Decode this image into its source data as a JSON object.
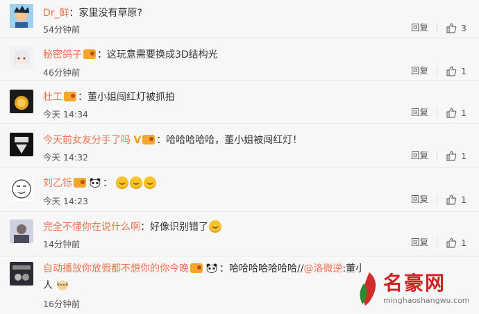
{
  "comments": [
    {
      "user": "Dr_鲜",
      "text": "家里没有草原?",
      "time": "54分钟前",
      "likes": "3"
    },
    {
      "user": "秘密鸽子",
      "text": "这玩意需要换成3D结构光",
      "time": "46分钟前",
      "likes": "1"
    },
    {
      "user": "杜工",
      "text": "董小姐闯红灯被抓拍",
      "time": "今天 14:34",
      "likes": "1"
    },
    {
      "user": "今天前女友分手了吗",
      "text": "哈哈哈哈哈，董小姐被闯红灯！",
      "time": "今天 14:32",
      "likes": "1"
    },
    {
      "user": "刘乙铄",
      "text": "",
      "time": "今天 14:23",
      "likes": "1"
    },
    {
      "user": "完全不懂你在说什么啊",
      "text": "好像识别错了",
      "time": "14分钟前",
      "likes": "1"
    },
    {
      "user": "自动播放你放假都不想你的你今晚",
      "text": "哈哈哈哈哈哈哈//",
      "mention": "@洛微逆",
      "text2": ":董小姐闯了想用空调外机打",
      "text_line2": "人",
      "time": "16分钟前",
      "likes": ""
    }
  ],
  "reply_label": "回复",
  "watermark": {
    "name": "名豪网",
    "url": "minghaoshangwu.com"
  }
}
